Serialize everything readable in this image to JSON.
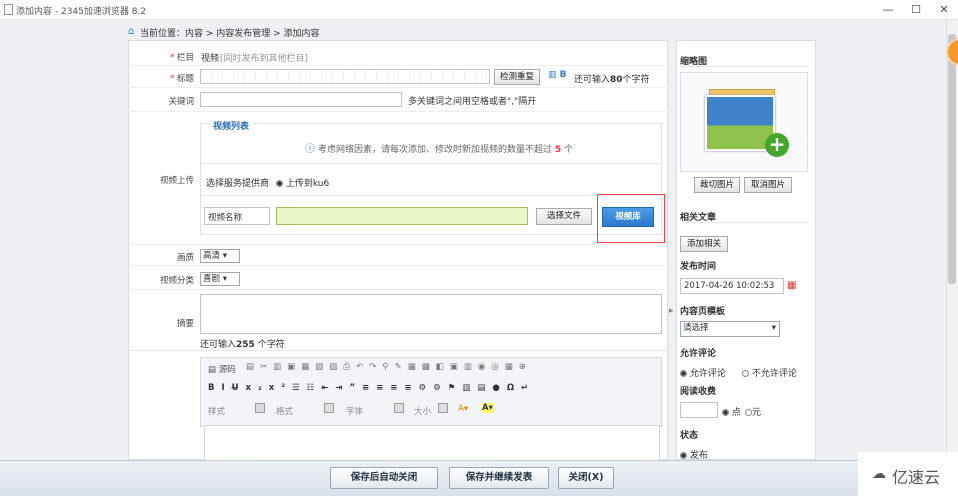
{
  "window": {
    "title": "添加内容 - 2345加速浏览器 8.2",
    "minimize": "—",
    "maximize": "☐",
    "close": "✕"
  },
  "breadcrumb": {
    "text": "当前位置：内容 > 内容发布管理 > 添加内容"
  },
  "form": {
    "column": {
      "label": "栏目",
      "value": "视频",
      "hint": "[同时发布到其他栏目]"
    },
    "title": {
      "label": "标题",
      "check_button": "检测重复",
      "remaining": "还可输入",
      "remaining_count": "80",
      "unit": "个字符"
    },
    "keywords": {
      "label": "关键词",
      "hint": "多关键词之间用空格或者\",\"隔开"
    },
    "video": {
      "label": "视频上传",
      "legend": "视频列表",
      "notice": "考虑网络因素，请每次添加、修改时新加视频的数量不超过",
      "notice_count": "5",
      "notice_unit": "个",
      "provider_label": "选择服务提供商",
      "provider_option": "上传到ku6",
      "name_placeholder": "视频名称",
      "choose_file": "选择文件",
      "library_button": "视频库"
    },
    "quality": {
      "label": "画质",
      "value": "高清"
    },
    "category": {
      "label": "视频分类",
      "value": "喜剧"
    },
    "summary": {
      "label": "摘要",
      "remaining": "还可输入",
      "remaining_count": "255",
      "unit": "个字符"
    },
    "editor": {
      "source_label": "源码",
      "style_label": "样式",
      "format_label": "格式",
      "font_label": "字体",
      "size_label": "大小"
    }
  },
  "sidebar": {
    "thumbnail": {
      "heading": "缩略图",
      "crop_button": "裁切图片",
      "cancel_button": "取消图片"
    },
    "related": {
      "heading": "相关文章",
      "add_button": "添加相关"
    },
    "publish_time": {
      "heading": "发布时间",
      "value": "2017-04-26 10:02:53"
    },
    "template": {
      "heading": "内容页模板",
      "value": "请选择"
    },
    "comments": {
      "heading": "允许评论",
      "allow": "允许评论",
      "deny": "不允许评论"
    },
    "charge": {
      "heading": "阅读收费",
      "points": "点",
      "yuan": "元"
    },
    "status": {
      "heading": "状态",
      "publish": "发布"
    }
  },
  "footer": {
    "save_close": "保存后自动关闭",
    "save_continue": "保存并继续发表",
    "close": "关闭(X)"
  },
  "watermark": {
    "text": "亿速云"
  }
}
